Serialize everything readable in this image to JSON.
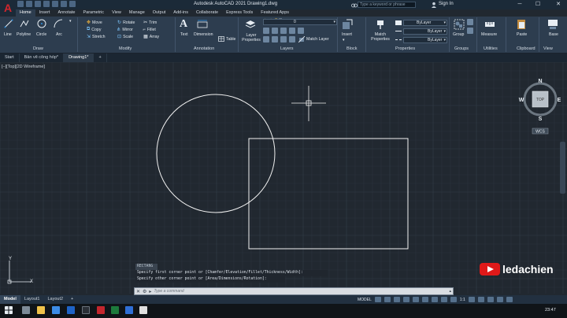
{
  "app": {
    "title": "Autodesk AutoCAD 2021   Drawing1.dwg",
    "search_placeholder": "Type a keyword or phrase",
    "sign_in": "Sign In",
    "logo": "A"
  },
  "ribbon_tabs": [
    "Home",
    "Insert",
    "Annotate",
    "Parametric",
    "View",
    "Manage",
    "Output",
    "Add-ins",
    "Collaborate",
    "Express Tools",
    "Featured Apps"
  ],
  "draw": {
    "panel": "Draw",
    "tools": [
      "Line",
      "Polyline",
      "Circle",
      "Arc"
    ]
  },
  "modify": {
    "panel": "Modify",
    "tools": [
      "Move",
      "Rotate",
      "Trim",
      "Copy",
      "Mirror",
      "Fillet",
      "Stretch",
      "Scale",
      "Array"
    ]
  },
  "annotation": {
    "panel": "Annotation",
    "tools": [
      "Text",
      "Dimension",
      "Table"
    ]
  },
  "layers": {
    "panel": "Layers",
    "layer_properties": "Layer Properties",
    "current_layer": "0",
    "match_layer": "Match Layer"
  },
  "block": {
    "panel": "Block",
    "insert": "Insert"
  },
  "properties": {
    "panel": "Properties",
    "match": "Match Properties",
    "values": [
      "ByLayer",
      "ByLayer",
      "ByLayer"
    ]
  },
  "groups": {
    "panel": "Groups",
    "group": "Group"
  },
  "utilities": {
    "panel": "Utilities",
    "measure": "Measure"
  },
  "clipboard": {
    "panel": "Clipboard",
    "paste": "Paste"
  },
  "view": {
    "panel": "View",
    "base": "Base"
  },
  "file_tabs": [
    "Start",
    "Bản vẽ công hóp*",
    "Drawing1*"
  ],
  "viewport_label": "[–][Top][2D Wireframe]",
  "viewcube": {
    "top": "TOP",
    "n": "N",
    "s": "S",
    "e": "E",
    "w": "W",
    "wcs": "WCS"
  },
  "ucs": {
    "x": "X",
    "y": "Y"
  },
  "command_history": [
    "RECTANG",
    "Specify first corner point or [Chamfer/Elevation/Fillet/Thickness/Width]:",
    "Specify other corner point or [Area/Dimensions/Rotation]:"
  ],
  "command_placeholder": "Type a command",
  "layout_tabs": [
    "Model",
    "Layout1",
    "Layout2"
  ],
  "status": {
    "model": "MODEL",
    "scale": "1:1"
  },
  "watermark": "ledachien",
  "clock": "23:47",
  "colors": {
    "canvas_bg": "#212830",
    "grid_minor": "#2a323c",
    "grid_major": "#333d49",
    "accent_red": "#d0262d"
  }
}
